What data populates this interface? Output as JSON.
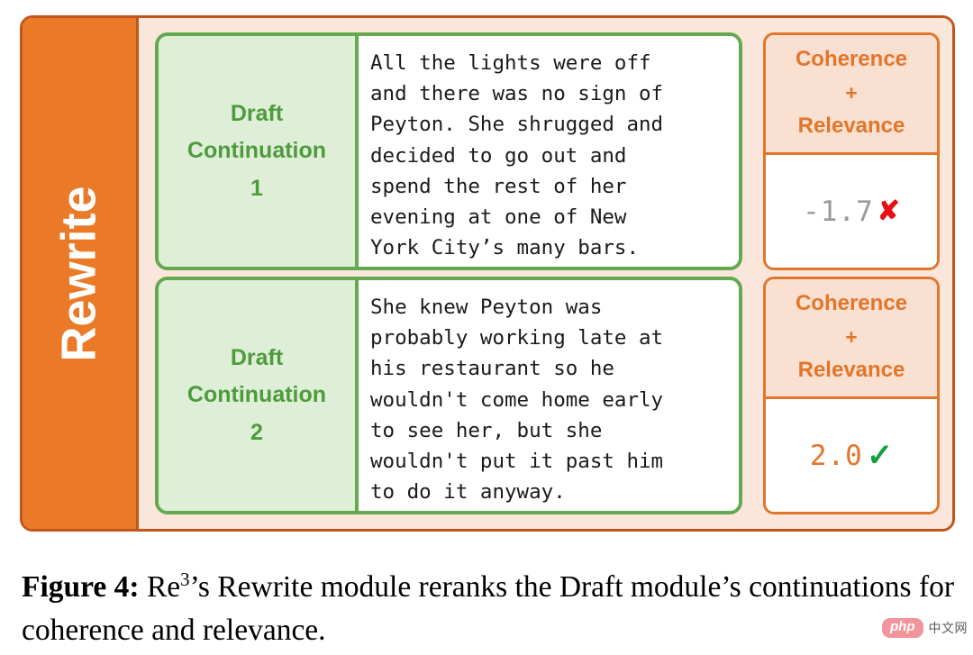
{
  "figure": {
    "module_label": "Rewrite",
    "rows": [
      {
        "continuation_label_line1": "Draft",
        "continuation_label_line2": "Continuation",
        "continuation_label_line3": "1",
        "continuation_text": "All the lights were off\nand there was no sign of\nPeyton. She shrugged and\ndecided to go out and\nspend the rest of her\nevening at one of New\nYork City’s many bars.",
        "score_head_line1": "Coherence",
        "score_head_plus": "+",
        "score_head_line2": "Relevance",
        "score_value": "-1.7",
        "verdict_icon": "cross-icon",
        "verdict_glyph": "✘"
      },
      {
        "continuation_label_line1": "Draft",
        "continuation_label_line2": "Continuation",
        "continuation_label_line3": "2",
        "continuation_text": "She knew Peyton was\nprobably working late at\nhis restaurant so he\nwouldn't come home early\nto see her, but she\nwouldn't put it past him\nto do it anyway.",
        "score_head_line1": "Coherence",
        "score_head_plus": "+",
        "score_head_line2": "Relevance",
        "score_value": "2.0",
        "verdict_icon": "check-icon",
        "verdict_glyph": "✓"
      }
    ]
  },
  "caption": {
    "label": "Figure 4:",
    "text_before_sup": " Re",
    "superscript": "3",
    "text_after_sup": "’s Rewrite module reranks the Draft module’s continuations for coherence and relevance."
  },
  "watermark": {
    "pill_text": "php",
    "site_text": "中文网"
  },
  "colors": {
    "module_orange": "#ea7a28",
    "frame_border": "#c0561d",
    "panel_peach": "#fae6db",
    "green_border": "#63a950",
    "green_fill": "#dfeed6",
    "green_text": "#4e9b3e",
    "score_border": "#e1762b",
    "score_head_fill": "#fae0d0",
    "score_orange_text": "#e1762b",
    "score_gray_text": "#9a9a9a",
    "cross_red": "#e60f14",
    "check_green": "#14a03c",
    "watermark_pink": "#f2949b"
  }
}
